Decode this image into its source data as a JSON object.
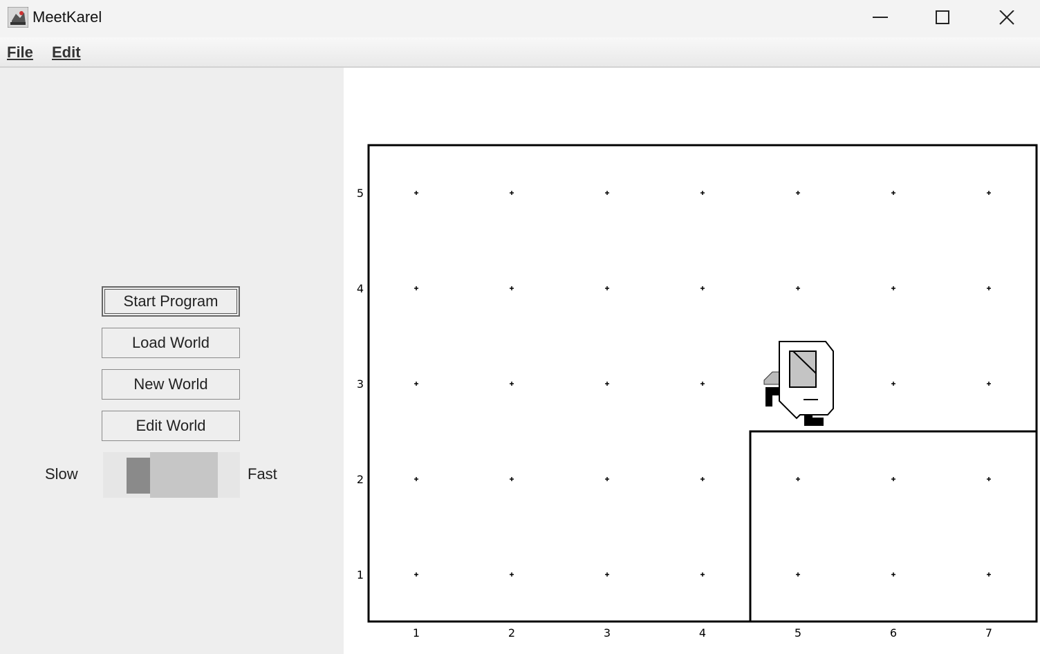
{
  "window": {
    "title": "MeetKarel"
  },
  "menu": {
    "items": [
      {
        "label": "File"
      },
      {
        "label": "Edit"
      }
    ]
  },
  "controls": {
    "start_label": "Start Program",
    "load_label": "Load World",
    "new_label": "New World",
    "edit_label": "Edit World",
    "speed": {
      "slow_label": "Slow",
      "fast_label": "Fast",
      "value": 0.35
    }
  },
  "world": {
    "columns": [
      "1",
      "2",
      "3",
      "4",
      "5",
      "6",
      "7"
    ],
    "rows": [
      "1",
      "2",
      "3",
      "4",
      "5"
    ],
    "karel": {
      "avenue": 5,
      "street": 3,
      "facing": "west"
    },
    "walls": [
      {
        "type": "box",
        "avenues": [
          5,
          7
        ],
        "streets": [
          1,
          2
        ]
      }
    ]
  }
}
